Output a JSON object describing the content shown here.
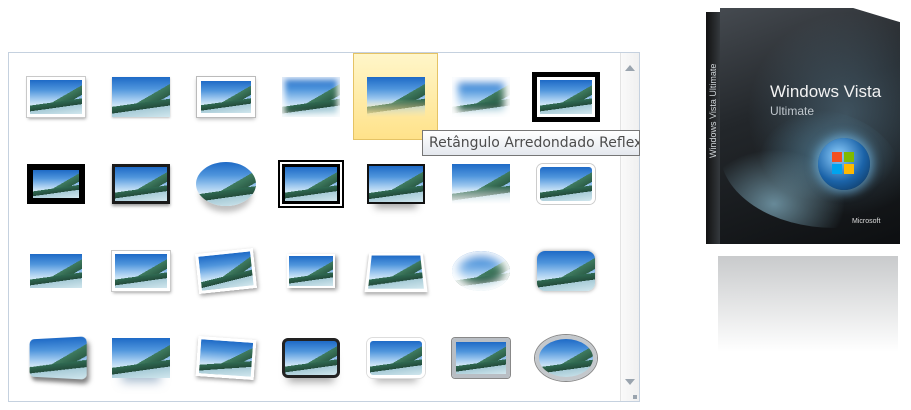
{
  "gallery": {
    "styles": [
      "s-white",
      "s-plain",
      "s-frame",
      "s-soft",
      "s-fade",
      "s-soft2",
      "s-double",
      "s-black",
      "s-dark",
      "s-oval",
      "s-dblblk",
      "s-reflect",
      "s-fade",
      "s-round",
      "s-cut",
      "s-white",
      "s-tilt",
      "s-small",
      "s-persp",
      "s-blur",
      "s-rnd2",
      "s-bevel",
      "s-refl2",
      "s-tilt2",
      "s-rblack",
      "s-rwhite",
      "s-metal",
      "s-ovalmet"
    ],
    "hovered_index": 4,
    "tooltip": "Retângulo Arredondado Reflexo"
  },
  "product_box": {
    "title": "Windows Vista",
    "edition": "Ultimate",
    "spine": "Windows Vista Ultimate",
    "brand": "Microsoft"
  }
}
